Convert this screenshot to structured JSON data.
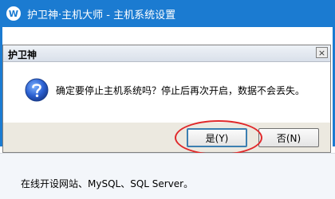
{
  "app": {
    "logo_char": "W",
    "title": "护卫神·主机大师 - 主机系统设置"
  },
  "dialog": {
    "title": "护卫神",
    "close_glyph": "×",
    "message": "确定要停止主机系统吗？停止后再次开启，数据不会丢失。",
    "buttons": {
      "yes": "是(Y)",
      "no": "否(N)"
    }
  },
  "footer": {
    "text": "在线开设网站、MySQL、SQL Server。"
  },
  "colors": {
    "brand": "#1b7bd1",
    "highlight": "#e0282a"
  },
  "icons": {
    "dialog_icon": "question-icon"
  }
}
